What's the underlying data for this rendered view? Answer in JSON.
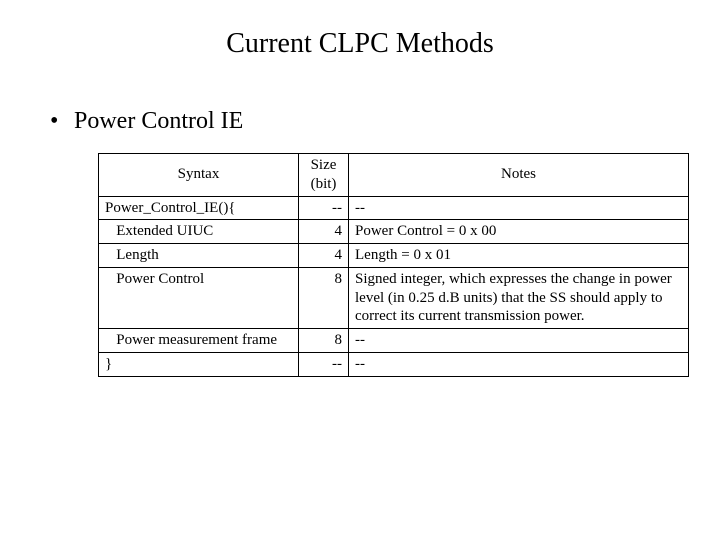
{
  "title": "Current CLPC Methods",
  "bullet": "Power Control IE",
  "table": {
    "headers": {
      "syntax": "Syntax",
      "size": "Size\n(bit)",
      "notes": "Notes"
    },
    "rows": [
      {
        "syntax": "Power_Control_IE(){",
        "size": "--",
        "notes": "--"
      },
      {
        "syntax": "   Extended UIUC",
        "size": "4",
        "notes": "Power Control = 0 x 00"
      },
      {
        "syntax": "   Length",
        "size": "4",
        "notes": "Length = 0 x 01"
      },
      {
        "syntax": "   Power Control",
        "size": "8",
        "notes": "Signed integer, which expresses the change in power level (in 0.25 d.B units) that the SS should apply to correct its current transmission power."
      },
      {
        "syntax": "   Power measurement frame",
        "size": "8",
        "notes": "--"
      },
      {
        "syntax": "}",
        "size": "--",
        "notes": "--"
      }
    ]
  }
}
